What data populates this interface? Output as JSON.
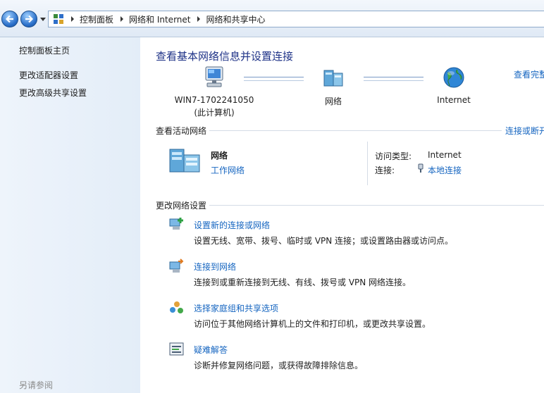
{
  "address_bar": {
    "breadcrumbs": [
      "控制面板",
      "网络和 Internet",
      "网络和共享中心"
    ]
  },
  "sidebar": {
    "items": [
      {
        "label": "控制面板主页"
      },
      {
        "label": "更改适配器设置"
      },
      {
        "label": "更改高级共享设置"
      }
    ],
    "see_also": "另请参阅"
  },
  "main": {
    "title": "查看基本网络信息并设置连接",
    "view_full_map": "查看完整",
    "map": {
      "computer_name": "WIN7-1702241050",
      "computer_sub": "(此计算机)",
      "network_label": "网络",
      "internet_label": "Internet"
    },
    "active_networks": {
      "heading": "查看活动网络",
      "right_link": "连接或断开",
      "network_name": "网络",
      "network_type": "工作网络",
      "access_type_label": "访问类型:",
      "access_type_value": "Internet",
      "connection_label": "连接:",
      "connection_value": "本地连接"
    },
    "change_settings": {
      "heading": "更改网络设置",
      "tasks": [
        {
          "title": "设置新的连接或网络",
          "desc": "设置无线、宽带、拨号、临时或 VPN 连接；或设置路由器或访问点。",
          "icon": "new-connection-icon"
        },
        {
          "title": "连接到网络",
          "desc": "连接到或重新连接到无线、有线、拨号或 VPN 网络连接。",
          "icon": "connect-network-icon"
        },
        {
          "title": "选择家庭组和共享选项",
          "desc": "访问位于其他网络计算机上的文件和打印机，或更改共享设置。",
          "icon": "homegroup-icon"
        },
        {
          "title": "疑难解答",
          "desc": "诊断并修复网络问题，或获得故障排除信息。",
          "icon": "troubleshoot-icon"
        }
      ]
    }
  }
}
